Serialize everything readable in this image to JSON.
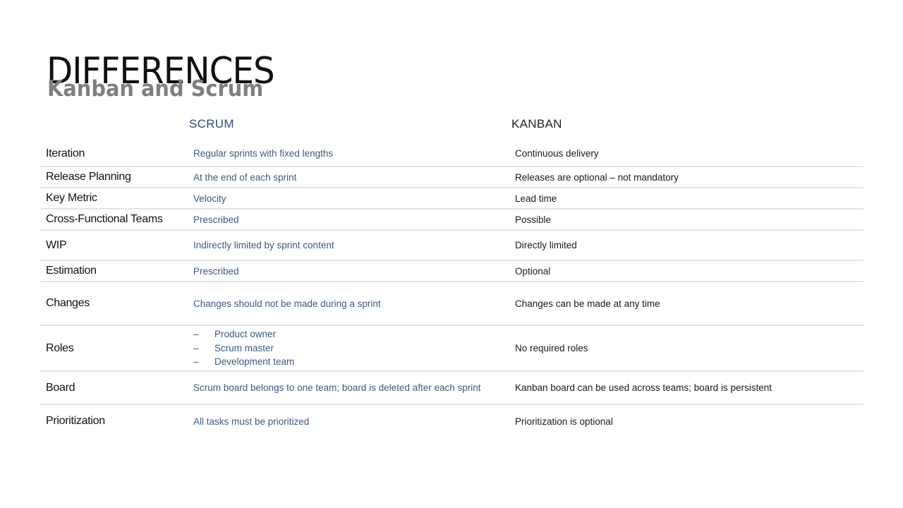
{
  "slide": {
    "title": "DIFFERENCES",
    "subtitle": "Kanban and Scrum"
  },
  "table": {
    "headers": {
      "scrum": "SCRUM",
      "kanban": "KANBAN"
    },
    "rows": [
      {
        "label": "Iteration",
        "scrum": "Regular sprints with fixed lengths",
        "kanban": "Continuous delivery"
      },
      {
        "label": "Release Planning",
        "scrum": "At the end of each sprint",
        "kanban": "Releases are optional – not mandatory"
      },
      {
        "label": "Key Metric",
        "scrum": "Velocity",
        "kanban": "Lead time"
      },
      {
        "label": "Cross-Functional Teams",
        "scrum": "Prescribed",
        "kanban": "Possible"
      },
      {
        "label": "WIP",
        "scrum": "Indirectly limited by sprint content",
        "kanban": "Directly limited"
      },
      {
        "label": "Estimation",
        "scrum": "Prescribed",
        "kanban": "Optional"
      },
      {
        "label": "Changes",
        "scrum": "Changes should not be made during a sprint",
        "kanban": "Changes can be made at any time"
      },
      {
        "label": "Roles",
        "scrum_list": [
          "Product owner",
          "Scrum master",
          "Development team"
        ],
        "list_marker": "–",
        "kanban": "No required roles"
      },
      {
        "label": "Board",
        "scrum": "Scrum board belongs to one team; board is deleted after each sprint",
        "kanban": "Kanban board can be used across teams; board is persistent"
      },
      {
        "label": "Prioritization",
        "scrum": "All tasks must be prioritized",
        "kanban": "Prioritization is optional"
      }
    ]
  },
  "colors": {
    "scrum_text": "#3d5a80",
    "scrum_header": "#2e4d7b",
    "subtitle": "#7f7f7f",
    "divider": "#e4e4e4"
  }
}
